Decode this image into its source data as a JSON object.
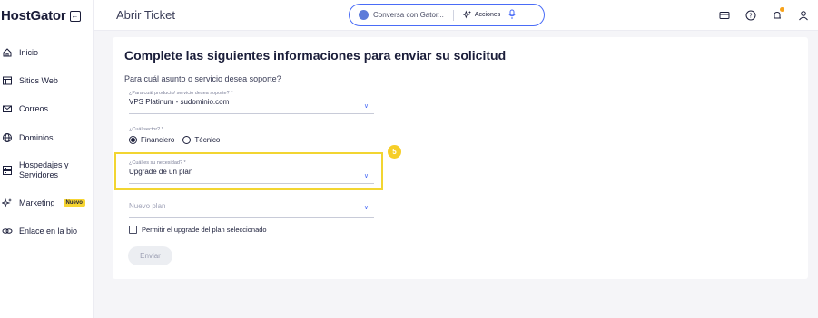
{
  "app": {
    "logo": "HostGator"
  },
  "sidebar": {
    "items": [
      {
        "label": "Inicio",
        "icon": "home-icon"
      },
      {
        "label": "Sitios Web",
        "icon": "window-icon"
      },
      {
        "label": "Correos",
        "icon": "mail-icon"
      },
      {
        "label": "Dominios",
        "icon": "globe-icon"
      },
      {
        "label": "Hospedajes y Servidores",
        "icon": "server-icon"
      },
      {
        "label": "Marketing",
        "icon": "sparkle-icon",
        "badge": "Nuevo"
      },
      {
        "label": "Enlace en la bio",
        "icon": "link-icon"
      }
    ]
  },
  "header": {
    "title": "Abrir Ticket",
    "assistant_placeholder": "Conversa con Gator...",
    "actions_label": "Acciones"
  },
  "form": {
    "title": "Complete las siguientes informaciones para enviar su solicitud",
    "subtitle": "Para cuál asunto o servicio desea soporte?",
    "product": {
      "label": "¿Para cuál producto/ servicio desea soporte? *",
      "value": "VPS Platinum - sudominio.com"
    },
    "sector": {
      "label": "¿Cuál sector? *",
      "options": [
        "Financiero",
        "Técnico"
      ],
      "selected": "Financiero"
    },
    "need": {
      "label": "¿Cuál es su necesidad? *",
      "value": "Upgrade de un plan"
    },
    "new_plan": {
      "placeholder": "Nuevo plan"
    },
    "permit_label": "Permitir el upgrade del plan seleccionado",
    "submit_label": "Enviar",
    "step_number": "5"
  },
  "colors": {
    "accent": "#4a6cf7",
    "highlight": "#f2d531",
    "badge": "#f7d531"
  }
}
